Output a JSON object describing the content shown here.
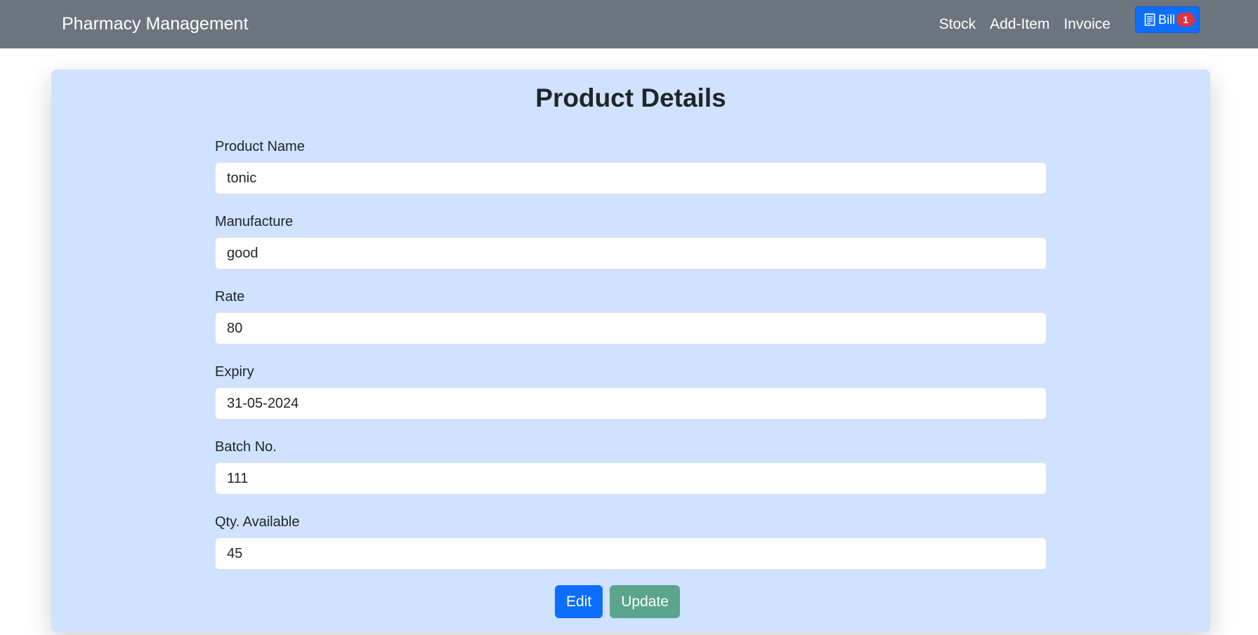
{
  "navbar": {
    "brand": "Pharmacy Management",
    "links": [
      "Stock",
      "Add-Item",
      "Invoice"
    ],
    "bill_label": "Bill",
    "bill_count": "1",
    "bill_icon": "receipt-icon"
  },
  "product": {
    "title": "Product Details",
    "fields": [
      {
        "label": "Product Name",
        "value": "tonic"
      },
      {
        "label": "Manufacture",
        "value": "good"
      },
      {
        "label": "Rate",
        "value": "80"
      },
      {
        "label": "Expiry",
        "value": "31-05-2024"
      },
      {
        "label": "Batch No.",
        "value": "111"
      },
      {
        "label": "Qty. Available",
        "value": "45"
      }
    ],
    "edit_label": "Edit",
    "update_label": "Update"
  },
  "colors": {
    "navbar": "#6c757d",
    "card": "#cfe2ff",
    "primary": "#0d6efd",
    "update": "#5aa58c",
    "badge": "#dc3545"
  }
}
